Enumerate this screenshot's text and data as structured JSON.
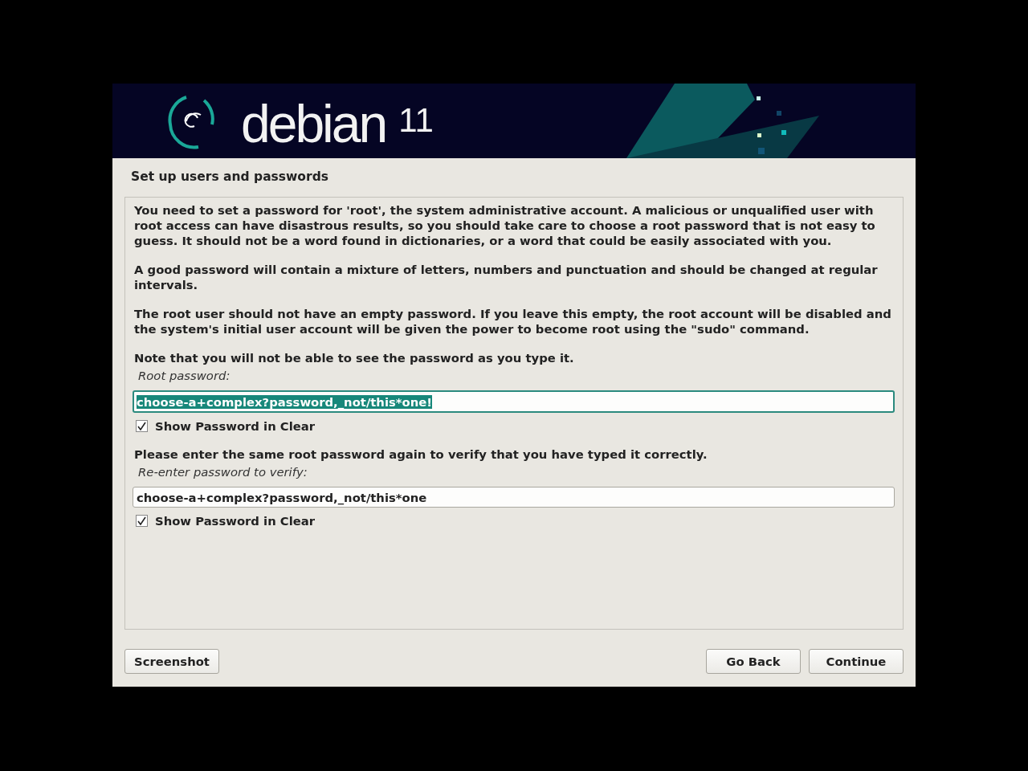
{
  "banner": {
    "logo_text": "debian",
    "version": "11"
  },
  "title": "Set up users and passwords",
  "paragraphs": [
    "You need to set a password for 'root', the system administrative account. A malicious or unqualified user with root access can have disastrous results, so you should take care to choose a root password that is not easy to guess. It should not be a word found in dictionaries, or a word that could be easily associated with you.",
    "A good password will contain a mixture of letters, numbers and punctuation and should be changed at regular intervals.",
    "The root user should not have an empty password. If you leave this empty, the root account will be disabled and the system's initial user account will be given the power to become root using the \"sudo\" command.",
    "Note that you will not be able to see the password as you type it."
  ],
  "fields": [
    {
      "label": "Root password:",
      "value": "choose-a+complex?password,_not/this*one!",
      "focused": true,
      "checkbox": {
        "label": "Show Password in Clear",
        "checked": true
      }
    },
    {
      "intro": "Please enter the same root password again to verify that you have typed it correctly.",
      "label": "Re-enter password to verify:",
      "value": "choose-a+complex?password,_not/this*one",
      "focused": false,
      "checkbox": {
        "label": "Show Password in Clear",
        "checked": true
      }
    }
  ],
  "buttons": {
    "left": [
      "Screenshot"
    ],
    "right": [
      "Go Back",
      "Continue"
    ]
  }
}
